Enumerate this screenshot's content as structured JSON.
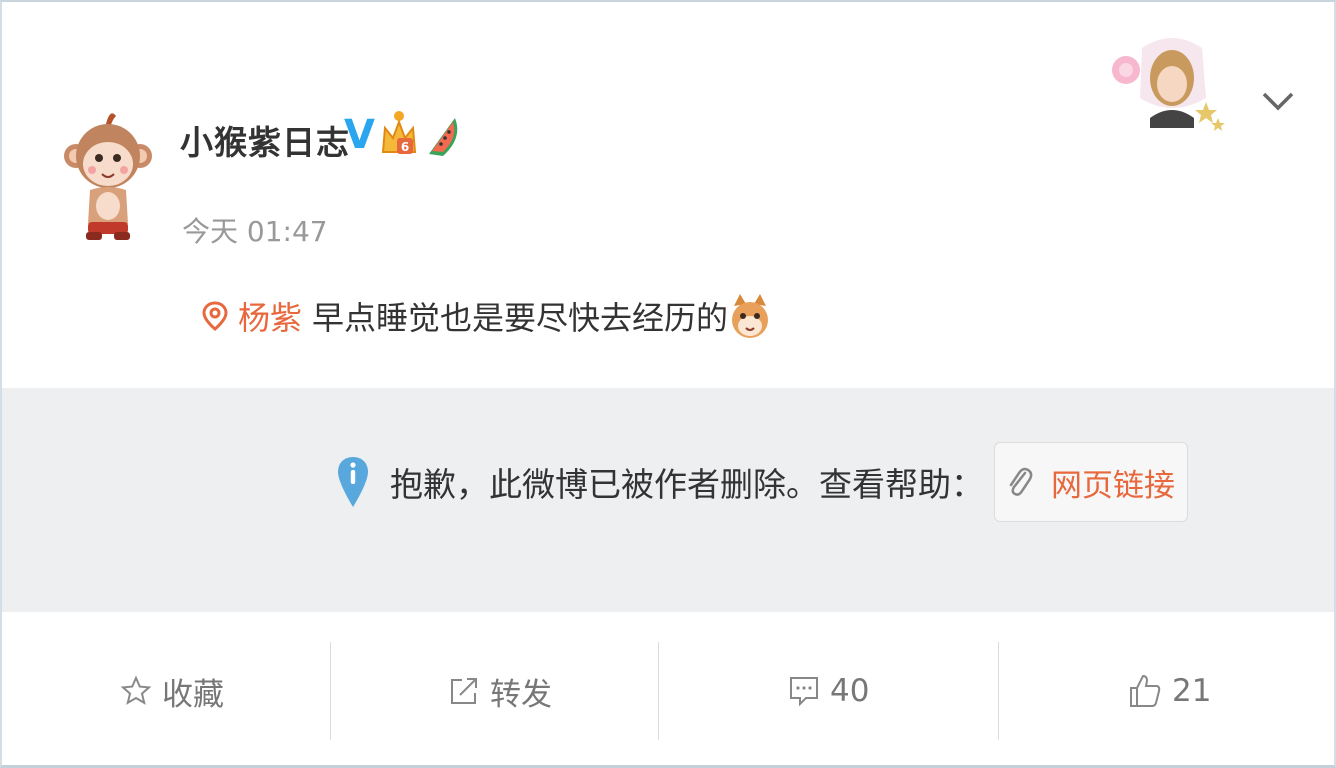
{
  "post": {
    "username": "小猴紫日志",
    "verified_badge": "V",
    "timestamp": "今天 01:47",
    "location_name": "杨紫",
    "text": "早点睡觉也是要尽快去经历的",
    "emoji": "cat-emoji"
  },
  "deleted_notice": {
    "icon": "info-icon",
    "text": "抱歉，此微博已被作者删除。查看帮助：",
    "link_label": "网页链接",
    "link_icon": "paperclip-icon"
  },
  "actions": [
    {
      "icon": "star-icon",
      "label": "收藏"
    },
    {
      "icon": "share-icon",
      "label": "转发"
    },
    {
      "icon": "comment-icon",
      "label": "40"
    },
    {
      "icon": "thumb-up-icon",
      "label": "21"
    }
  ],
  "colors": {
    "link_orange": "#e8683e",
    "verified_blue": "#2aa6ee",
    "deleted_bg": "#eeeff1",
    "muted_text": "#999999"
  }
}
